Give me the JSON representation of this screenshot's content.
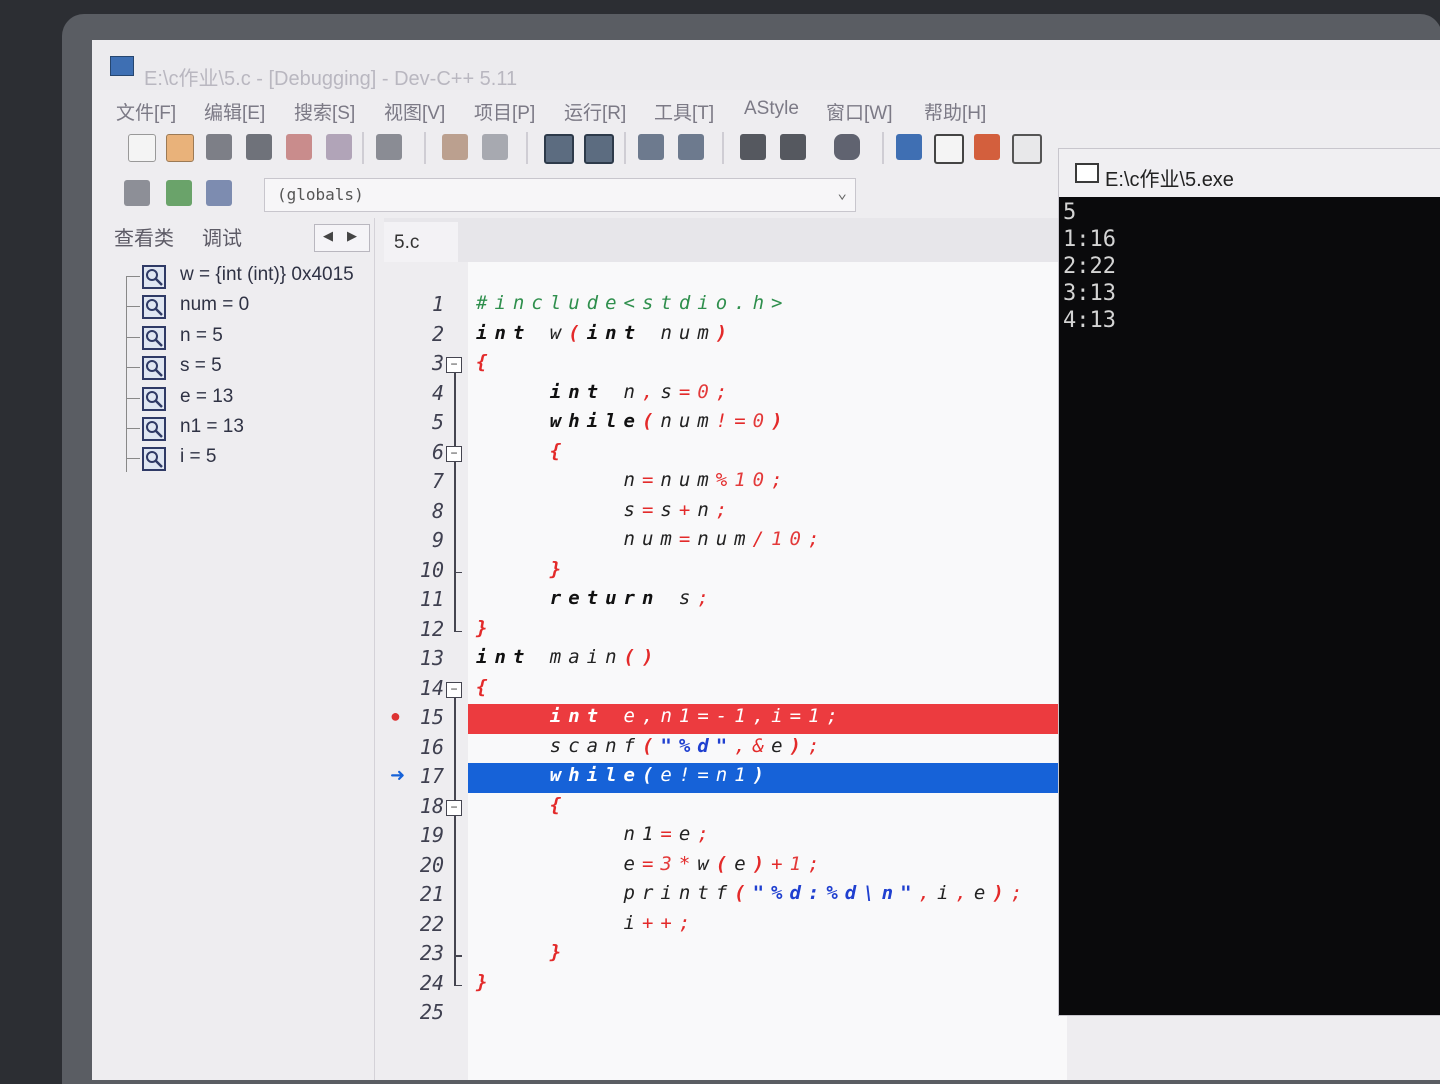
{
  "window": {
    "title": "E:\\c作业\\5.c - [Debugging] - Dev-C++ 5.11"
  },
  "menu": [
    "文件[F]",
    "编辑[E]",
    "搜索[S]",
    "视图[V]",
    "项目[P]",
    "运行[R]",
    "工具[T]",
    "AStyle",
    "窗口[W]",
    "帮助[H]"
  ],
  "toolbar": {
    "globals_value": "(globals)"
  },
  "left_panel": {
    "tabs": [
      "查看类",
      "调试"
    ],
    "watches": [
      "w = {int (int)} 0x4015",
      "num = 0",
      "n = 5",
      "s = 5",
      "e = 13",
      "n1 = 13",
      "i = 5"
    ]
  },
  "editor": {
    "tab_label": "5.c",
    "line_numbers": [
      "1",
      "2",
      "3",
      "4",
      "5",
      "6",
      "7",
      "8",
      "9",
      "10",
      "11",
      "12",
      "13",
      "14",
      "15",
      "16",
      "17",
      "18",
      "19",
      "20",
      "21",
      "22",
      "23",
      "24",
      "25"
    ],
    "breakpoint_line": 15,
    "current_line": 17,
    "code_lines": [
      "#include<stdio.h>",
      "int w(int num)",
      "{",
      "    int n,s=0;",
      "    while(num!=0)",
      "    {",
      "        n=num%10;",
      "        s=s+n;",
      "        num=num/10;",
      "    }",
      "    return s;",
      "}",
      "int main()",
      "{",
      "    int e,n1=-1,i=1;",
      "    scanf(\"%d\",&e);",
      "    while(e!=n1)",
      "    {",
      "        n1=e;",
      "        e=3*w(e)+1;",
      "        printf(\"%d:%d\\n\",i,e);",
      "        i++;",
      "    }",
      "}",
      ""
    ]
  },
  "console": {
    "title": "E:\\c作业\\5.exe",
    "lines": [
      "5",
      "1:16",
      "2:22",
      "3:13",
      "4:13"
    ]
  },
  "colors": {
    "breakpoint": "#ec3b3f",
    "current_line": "#1662d8",
    "keyword": "#111111",
    "number": "#e33a3a",
    "string": "#2040d0",
    "preprocessor": "#2f8f4d"
  }
}
